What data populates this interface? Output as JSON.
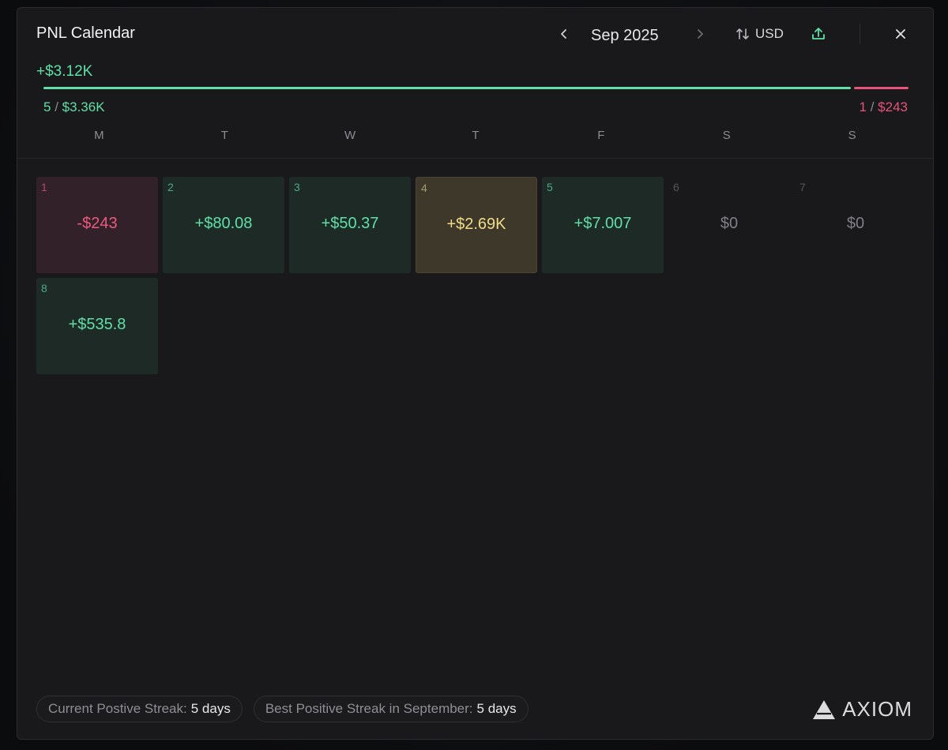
{
  "header": {
    "title": "PNL Calendar",
    "month": "Sep 2025",
    "currency": "USD",
    "icons": {
      "prev": "chevron-left-icon",
      "next": "chevron-right-icon",
      "currency": "swap-vertical-icon",
      "export": "share-upload-icon",
      "close": "close-icon"
    }
  },
  "summary": {
    "total": "+$3.12K",
    "positive_days": "5",
    "positive_amount": "$3.36K",
    "negative_days": "1",
    "negative_amount": "$243",
    "positive_share": 0.933,
    "separator": "/"
  },
  "weekdays": [
    "M",
    "T",
    "W",
    "T",
    "F",
    "S",
    "S"
  ],
  "days": [
    {
      "day": "1",
      "value": "-$243",
      "kind": "neg"
    },
    {
      "day": "2",
      "value": "+$80.08",
      "kind": "pos"
    },
    {
      "day": "3",
      "value": "+$50.37",
      "kind": "pos"
    },
    {
      "day": "4",
      "value": "+$2.69K",
      "kind": "best"
    },
    {
      "day": "5",
      "value": "+$7.007",
      "kind": "pos"
    },
    {
      "day": "6",
      "value": "$0",
      "kind": "zero"
    },
    {
      "day": "7",
      "value": "$0",
      "kind": "zero"
    },
    {
      "day": "8",
      "value": "+$535.8",
      "kind": "pos"
    }
  ],
  "footer": {
    "current_streak_label": "Current Postive Streak:",
    "current_streak_value": "5 days",
    "best_streak_label": "Best Positive Streak in September:",
    "best_streak_value": "5 days",
    "brand": "AXIOM"
  },
  "colors": {
    "positive": "#5ee0a8",
    "negative": "#e8527b",
    "best": "#f0dc8a",
    "background": "#19191b"
  }
}
